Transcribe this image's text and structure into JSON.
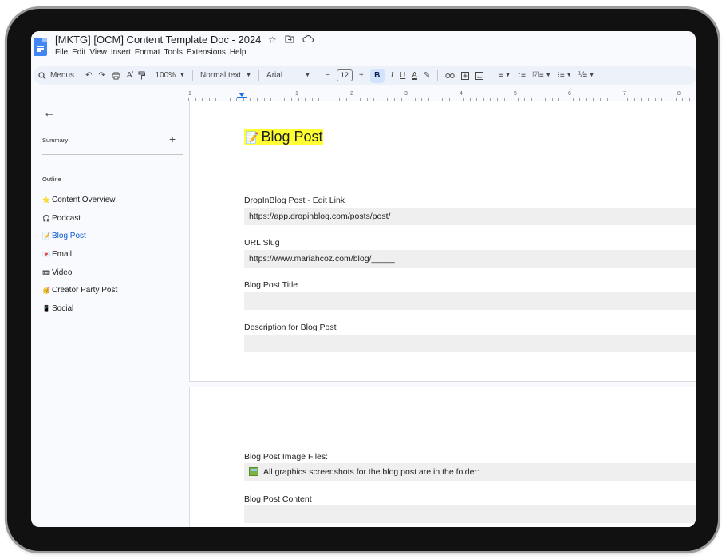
{
  "document": {
    "title": "[MKTG] [OCM] Content Template Doc - 2024",
    "title_icons": [
      "star-icon",
      "move-to-folder-icon",
      "cloud-status-icon"
    ]
  },
  "menu": [
    "File",
    "Edit",
    "View",
    "Insert",
    "Format",
    "Tools",
    "Extensions",
    "Help"
  ],
  "toolbar": {
    "search_label": "Menus",
    "zoom": "100%",
    "style": "Normal text",
    "font": "Arial",
    "font_size": "12",
    "minus": "−",
    "plus": "+",
    "bold": "B",
    "italic": "I",
    "underline": "U",
    "text_color": "A"
  },
  "ruler": {
    "numbers": [
      "1",
      "1",
      "2",
      "3",
      "4",
      "5",
      "6",
      "7",
      "8"
    ]
  },
  "sidebar": {
    "summary_label": "Summary",
    "summary_add": "+",
    "outline_label": "Outline",
    "items": [
      {
        "icon": "⭐",
        "label": "Content Overview",
        "active": false
      },
      {
        "icon": "🎧",
        "label": "Podcast",
        "active": false
      },
      {
        "icon": "📝",
        "label": "Blog Post",
        "active": true
      },
      {
        "icon": "💌",
        "label": "Email",
        "active": false
      },
      {
        "icon": "📼",
        "label": "Video",
        "active": false
      },
      {
        "icon": "🥳",
        "label": "Creator Party Post",
        "active": false
      },
      {
        "icon": "📱",
        "label": "Social",
        "active": false
      }
    ]
  },
  "page1": {
    "heading_icon": "📝",
    "heading": "Blog Post",
    "fields": [
      {
        "label": "DropInBlog Post - Edit Link",
        "value": "https://app.dropinblog.com/posts/post/"
      },
      {
        "label": "URL Slug",
        "value": "https://www.mariahcoz.com/blog/_____"
      },
      {
        "label": "Blog Post Title",
        "value": ""
      },
      {
        "label": "Description for Blog Post",
        "value": ""
      }
    ]
  },
  "page2": {
    "fields": [
      {
        "label": "Blog Post Image Files:",
        "value": "All graphics screenshots for the blog post are in the folder:"
      },
      {
        "label": "Blog Post Content",
        "value": ""
      }
    ]
  },
  "colors": {
    "highlight": "#ffff33",
    "field_fill": "#efefef",
    "active_outline": "#0b57d0",
    "toolbar_bg": "#edf2fa"
  }
}
